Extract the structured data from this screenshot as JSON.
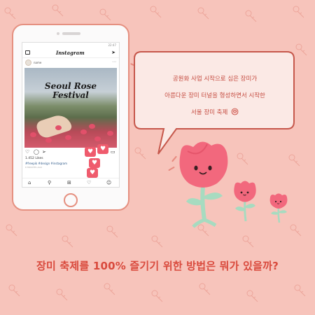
{
  "phone": {
    "status_time": "22:47",
    "app_logo": "Instagram",
    "username": "name",
    "photo_title_line1": "Seoul Rose",
    "photo_title_line2": "Festival",
    "likes": "1.452 Likes",
    "hashtags": "#freepik #design #instagram",
    "post_date": "8 MINUTES AGO",
    "notifications": [
      "♥",
      "♥",
      "♥",
      "♥"
    ]
  },
  "bubble": {
    "line1": "공원화 사업 시작으로 심은 장미가",
    "line2": "아름다운 장미 터널을 형성하면서 시작한",
    "line3": "서울 장미 축제"
  },
  "headline": "장미 축제를 100% 즐기기 위한 방법은 뭐가 있을까?",
  "colors": {
    "background": "#f7c4bb",
    "accent": "#d94a3d",
    "phone_border": "#e59080",
    "rose_pink": "#f2687d",
    "stem_green": "#a7dbc0"
  }
}
